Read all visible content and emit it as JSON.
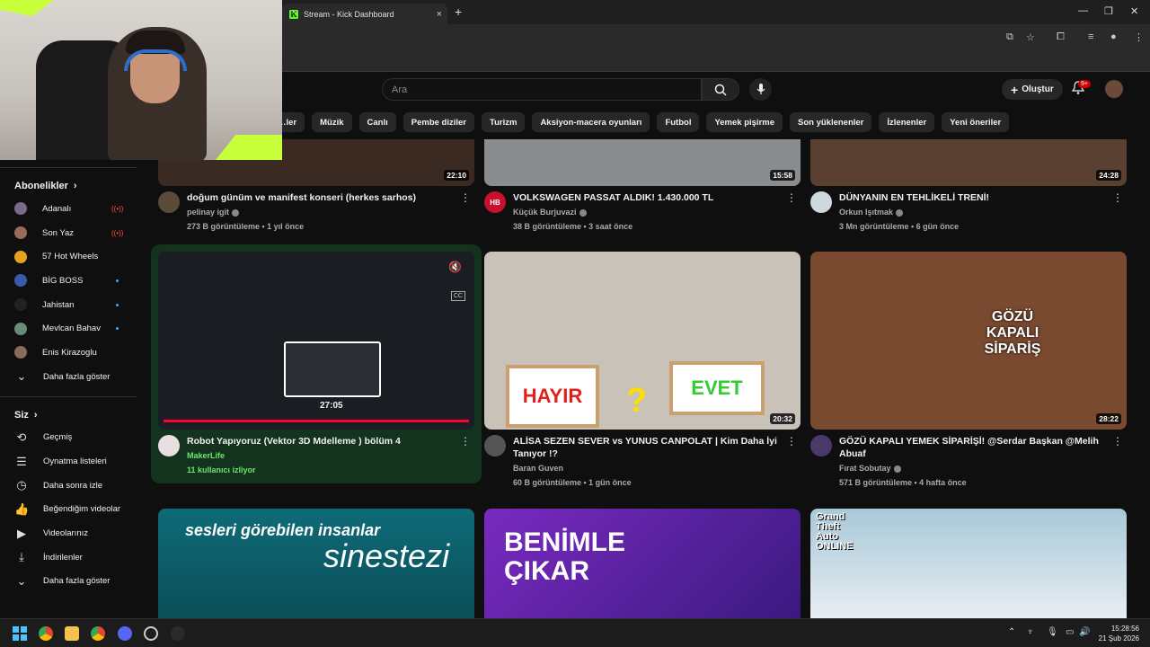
{
  "browser": {
    "tab_active": "Stream - Kick Dashboard",
    "close_glyph": "×",
    "new_tab_glyph": "+"
  },
  "header": {
    "search_placeholder": "Ara",
    "create_label": "Oluştur",
    "notification_count": "9+"
  },
  "chips": [
    "…ler",
    "Müzik",
    "Canlı",
    "Pembe diziler",
    "Turizm",
    "Aksiyon-macera oyunları",
    "Futbol",
    "Yemek pişirme",
    "Son yüklenenler",
    "İzlenenler",
    "Yeni öneriler"
  ],
  "sidebar": {
    "subs_heading": "Abonelikler",
    "subscriptions": [
      {
        "name": "Adanalı",
        "status": "live",
        "color": "#7a6a8a"
      },
      {
        "name": "Son Yaz",
        "status": "live",
        "color": "#9a6a5a"
      },
      {
        "name": "57 Hot Wheels",
        "status": "none",
        "color": "#e8a020"
      },
      {
        "name": "BİG BOSS",
        "status": "new",
        "color": "#3a5ab0"
      },
      {
        "name": "Jahistan",
        "status": "new",
        "color": "#222222"
      },
      {
        "name": "Mevlcan Bahav",
        "status": "new",
        "color": "#6a8a7a"
      },
      {
        "name": "Enis Kirazoglu",
        "status": "none",
        "color": "#8a6a5a"
      }
    ],
    "subs_more": "Daha fazla göster",
    "you_heading": "Siz",
    "you_items": [
      {
        "label": "Geçmiş",
        "icon": "history-icon",
        "glyph": "⟲"
      },
      {
        "label": "Oynatma listeleri",
        "icon": "playlist-icon",
        "glyph": "☰"
      },
      {
        "label": "Daha sonra izle",
        "icon": "clock-icon",
        "glyph": "◷"
      },
      {
        "label": "Beğendiğim videolar",
        "icon": "thumbs-up-icon",
        "glyph": "👍"
      },
      {
        "label": "Videolarınız",
        "icon": "video-icon",
        "glyph": "▶"
      },
      {
        "label": "İndirilenler",
        "icon": "download-icon",
        "glyph": "⤓"
      }
    ],
    "you_more": "Daha fazla göster"
  },
  "videos_row1": [
    {
      "title": "doğum günüm ve manifest konseri (herkes sarhos)",
      "channel": "pelinay igit",
      "stats": "273 B görüntüleme • 1 yıl önce",
      "duration": "22:10",
      "thumb": "#3a2a22",
      "avatar": "#5a4a3a"
    },
    {
      "title": "VOLKSWAGEN PASSAT ALDIK! 1.430.000 TL",
      "channel": "Küçük Burjuvazi",
      "stats": "38 B görüntüleme • 3 saat önce",
      "duration": "15:58",
      "thumb": "#8a8d90",
      "avatar": "#c8102e",
      "avatar_text": "HB"
    },
    {
      "title": "DÜNYANIN EN TEHLİKELİ TRENİ!",
      "channel": "Orkun Işıtmak",
      "stats": "3 Mn görüntüleme • 6 gün önce",
      "duration": "24:28",
      "thumb": "#5a4030",
      "avatar": "#cfd8dc"
    }
  ],
  "videos_row2": [
    {
      "title": "Robot Yapıyoruz (Vektor 3D Mdelleme ) bölüm 4",
      "channel": "MakerLife",
      "stats": "11 kullanıcı izliyor",
      "duration": "27:05",
      "thumb": "#1a1d22",
      "avatar": "#e8e0e0",
      "hover": true
    },
    {
      "title": "ALİSA SEZEN SEVER vs YUNUS CANPOLAT | Kim Daha İyi Tanıyor !?",
      "channel": "Baran Guven",
      "stats": "60 B görüntüleme • 1 gün önce",
      "duration": "20:32",
      "thumb": "#c9c2b8",
      "avatar": "#555555",
      "overlay_left": "HAYIR",
      "overlay_right": "EVET",
      "overlay_mid": "?"
    },
    {
      "title": "GÖZÜ KAPALI YEMEK SİPARİŞİ! @Serdar Başkan @Melih Abuaf",
      "channel": "Fırat Sobutay",
      "stats": "571 B görüntüleme • 4 hafta önce",
      "duration": "28:22",
      "thumb": "#7a4a30",
      "avatar": "#4a3a6a",
      "overlay_text": "GÖZÜ KAPALI SİPARİŞ"
    }
  ],
  "videos_row3": [
    {
      "text_top": "sesleri görebilen insanlar",
      "text_main": "sinestezi",
      "thumb": "#0d5c68"
    },
    {
      "text_main": "BENİMLE ÇIKAR",
      "thumb": "#6a2ab0"
    },
    {
      "text_main": "Grand Theft Auto ONLINE",
      "thumb": "#9ab8c8"
    }
  ],
  "taskbar": {
    "time": "15:28:56",
    "date": "21 Şub 2026"
  }
}
